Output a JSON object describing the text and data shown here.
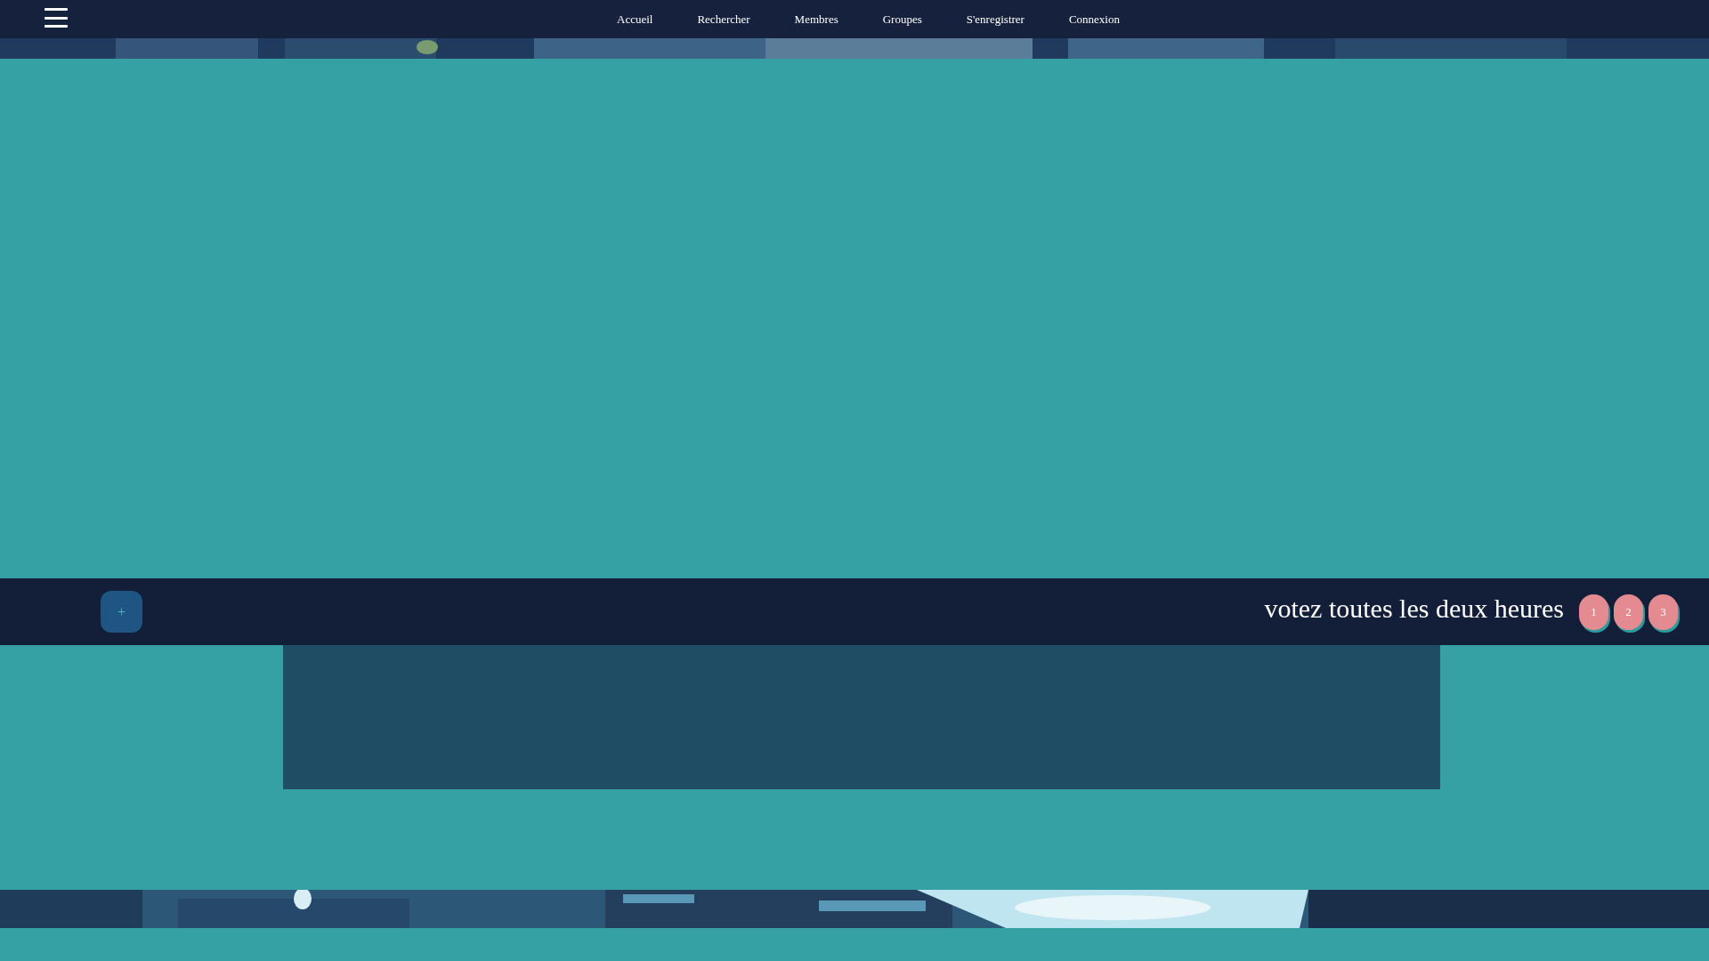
{
  "nav": {
    "items": [
      {
        "label": "Accueil"
      },
      {
        "label": "Rechercher"
      },
      {
        "label": "Membres"
      },
      {
        "label": "Groupes"
      },
      {
        "label": "S'enregistrer"
      },
      {
        "label": "Connexion"
      }
    ]
  },
  "vote_bar": {
    "toggle": "+",
    "text": "votez toutes les deux heures",
    "buttons": [
      "1",
      "2",
      "3"
    ]
  }
}
